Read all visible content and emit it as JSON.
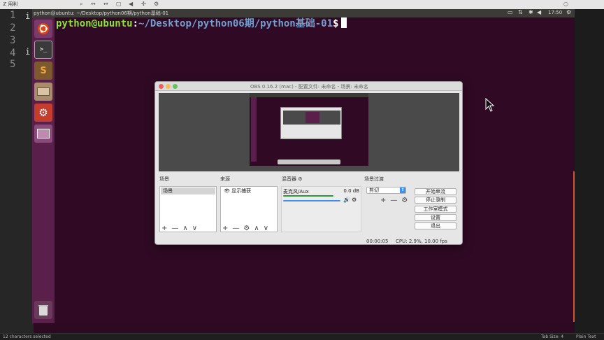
{
  "browser_tab": {
    "label": "ℤ 用利"
  },
  "gutter": {
    "lines": [
      "1",
      "2",
      "3",
      "4",
      "5"
    ],
    "marks": [
      "i",
      "i"
    ]
  },
  "panel": {
    "window_title": "python@ubuntu: ~/Desktop/python06期/python基础-01",
    "time": "17:50"
  },
  "terminal": {
    "user_host": "python@ubuntu",
    "sep": ":",
    "path": "~/Desktop/python06期/python基础-01",
    "symbol": "$"
  },
  "obs": {
    "title": "OBS 0.16.2 (mac) - 配置文件: 未命名 - 场景: 未命名",
    "sections": {
      "scenes": "场景",
      "sources": "来源",
      "mixer": "混音器",
      "transitions": "场景过渡"
    },
    "scenes": [
      "场景"
    ],
    "sources": [
      "显示捕获"
    ],
    "mixer": {
      "channel": "麦克风/Aux",
      "level": "0.0 dB",
      "volume_fraction": 0.95
    },
    "transition": {
      "selected": "剪切"
    },
    "buttons": [
      "开始串流",
      "停止录制",
      "工作室模式",
      "设置",
      "退出"
    ],
    "status": {
      "time": "00:00:05",
      "cpu": "CPU: 2.9%, 10.00 fps"
    },
    "toolbar_symbols": {
      "add": "+",
      "remove": "—",
      "gear": "⚙",
      "up": "∧",
      "down": "∨"
    }
  },
  "statusbar": {
    "left": "12 characters selected",
    "tab_size": "Tab Size: 4",
    "syntax": "Plain Text"
  },
  "colors": {
    "terminal_bg": "#300a24",
    "launcher": "#5b1f4b",
    "prompt_user": "#8ae234",
    "prompt_path": "#729fcf",
    "accent": "#d6532d"
  }
}
